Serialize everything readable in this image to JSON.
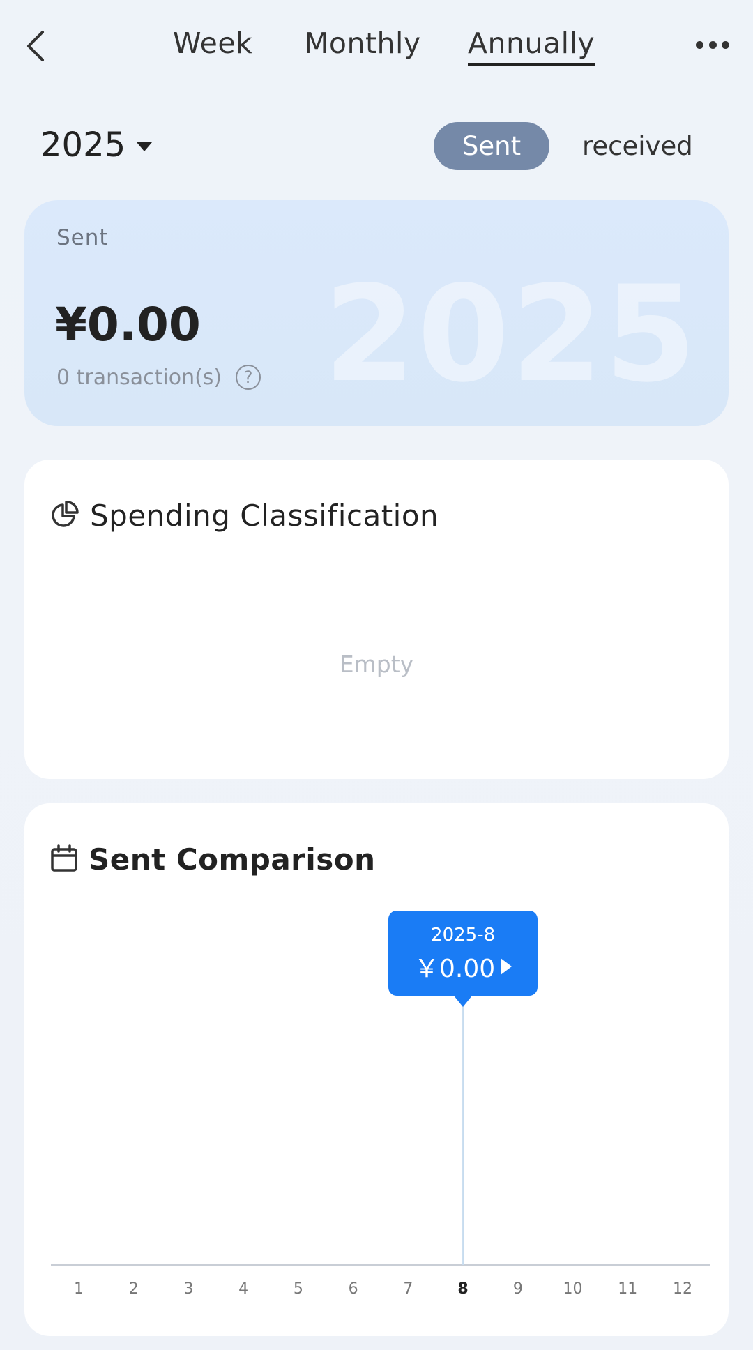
{
  "header": {
    "tabs": [
      {
        "label": "Week",
        "active": false
      },
      {
        "label": "Monthly",
        "active": false
      },
      {
        "label": "Annually",
        "active": true
      }
    ],
    "back_icon": "chevron-left-icon",
    "more_icon": "more-dots-icon"
  },
  "filter": {
    "year": "2025",
    "toggle": {
      "sent": "Sent",
      "received": "received",
      "selected": "sent"
    }
  },
  "summary": {
    "label": "Sent",
    "amount": "¥0.00",
    "transactions": "0 transaction(s)",
    "watermark_year": "2025"
  },
  "classification": {
    "title": "Spending Classification",
    "empty_text": "Empty",
    "icon": "pie-chart-icon"
  },
  "comparison": {
    "title": "Sent Comparison",
    "icon": "calendar-icon",
    "tooltip": {
      "date": "2025-8",
      "value": "￥0.00"
    }
  },
  "colors": {
    "accent": "#1a7cf5",
    "toggle_active": "#7589a8"
  },
  "chart_data": {
    "type": "line",
    "x": [
      "1",
      "2",
      "3",
      "4",
      "5",
      "6",
      "7",
      "8",
      "9",
      "10",
      "11",
      "12"
    ],
    "series": [
      {
        "values": [
          0,
          0,
          0,
          0,
          0,
          0,
          0,
          0,
          0,
          0,
          0,
          0
        ]
      }
    ],
    "selected_index": 7,
    "title": "Sent Comparison",
    "grid": false
  }
}
